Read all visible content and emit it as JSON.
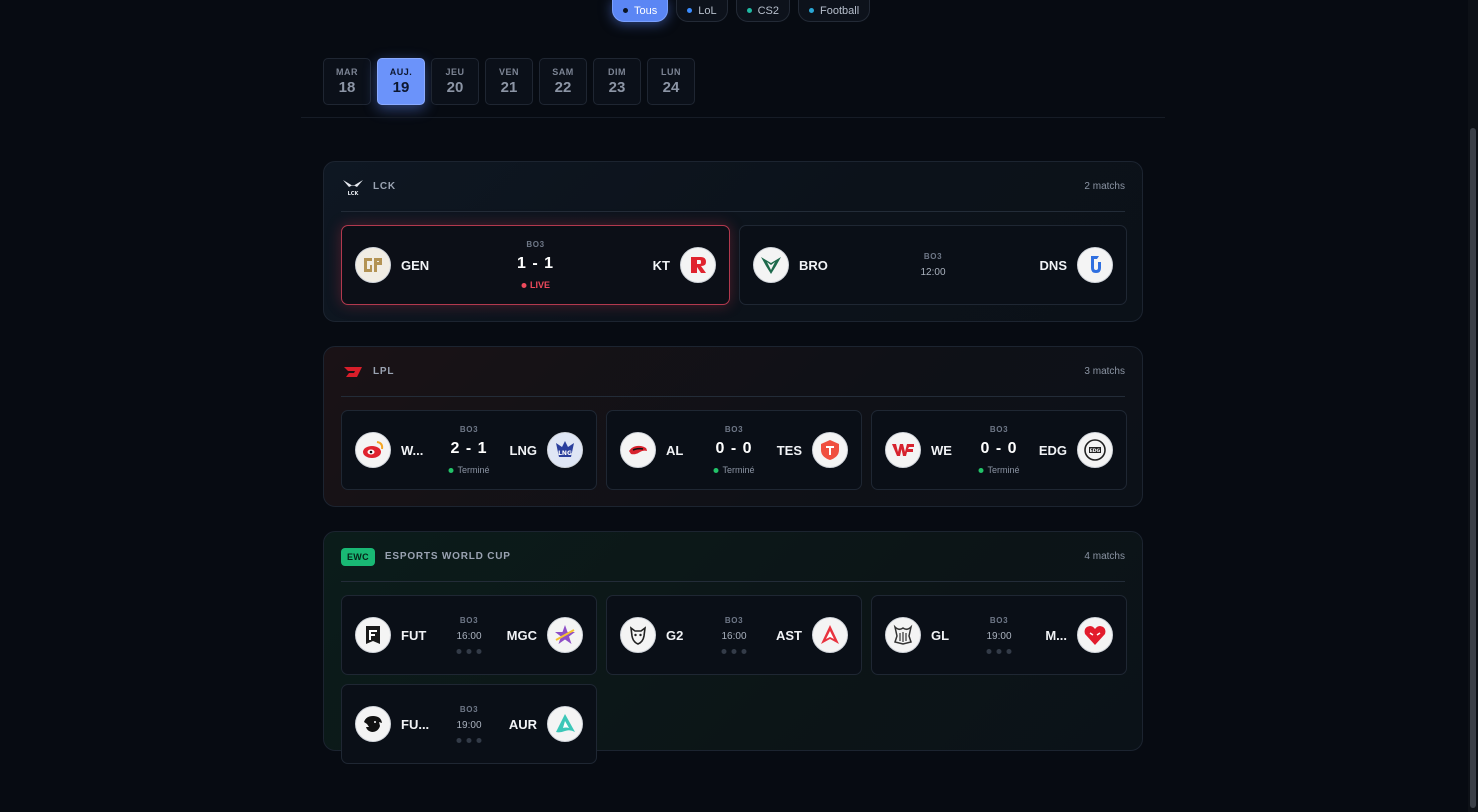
{
  "filters": [
    {
      "label": "Tous",
      "active": true,
      "dot": "#0b1424"
    },
    {
      "label": "LoL",
      "active": false,
      "dot": "#3b8cff"
    },
    {
      "label": "CS2",
      "active": false,
      "dot": "#1fb8a2"
    },
    {
      "label": "Football",
      "active": false,
      "dot": "#2aa7d6"
    }
  ],
  "days": [
    {
      "name": "MAR",
      "num": "18"
    },
    {
      "name": "AUJ.",
      "num": "19",
      "active": true
    },
    {
      "name": "JEU",
      "num": "20"
    },
    {
      "name": "VEN",
      "num": "21"
    },
    {
      "name": "SAM",
      "num": "22"
    },
    {
      "name": "DIM",
      "num": "23"
    },
    {
      "name": "LUN",
      "num": "24"
    }
  ],
  "lck": {
    "name": "LCK",
    "count": "2 matchs",
    "matches": [
      {
        "home": "GEN",
        "away": "KT",
        "format": "BO3",
        "score": "1 - 1",
        "status": "LIVE"
      },
      {
        "home": "BRO",
        "away": "DNS",
        "format": "BO3",
        "time": "12:00"
      }
    ]
  },
  "lpl": {
    "name": "LPL",
    "count": "3 matchs",
    "matches": [
      {
        "home": "W...",
        "away": "LNG",
        "format": "BO3",
        "score": "2 - 1",
        "status": "Terminé"
      },
      {
        "home": "AL",
        "away": "TES",
        "format": "BO3",
        "score": "0 - 0",
        "status": "Terminé"
      },
      {
        "home": "WE",
        "away": "EDG",
        "format": "BO3",
        "score": "0 - 0",
        "status": "Terminé"
      }
    ]
  },
  "ewc": {
    "badge": "EWC",
    "name": "ESPORTS WORLD CUP",
    "count": "4 matchs",
    "matches": [
      {
        "home": "FUT",
        "away": "MGC",
        "format": "BO3",
        "time": "16:00"
      },
      {
        "home": "G2",
        "away": "AST",
        "format": "BO3",
        "time": "16:00"
      },
      {
        "home": "GL",
        "away": "M...",
        "format": "BO3",
        "time": "19:00"
      },
      {
        "home": "FU...",
        "away": "AUR",
        "format": "BO3",
        "time": "19:00"
      }
    ]
  },
  "colors": {
    "accent": "#6b93fa",
    "live": "#ee4a5c",
    "done": "#22c268",
    "ewc": "#19b874"
  }
}
